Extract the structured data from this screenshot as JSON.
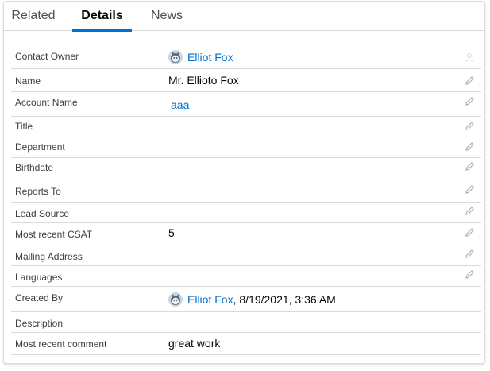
{
  "tabs": [
    {
      "label": "Related"
    },
    {
      "label": "Details"
    },
    {
      "label": "News"
    }
  ],
  "accent_color": "#0070d2",
  "fields": {
    "contact_owner": {
      "label": "Contact Owner",
      "value": "Elliot Fox",
      "icon": "user-avatar-icon"
    },
    "name": {
      "label": "Name",
      "value": "Mr. Ellioto Fox"
    },
    "account_name": {
      "label": "Account Name",
      "value": "aaa"
    },
    "title": {
      "label": "Title",
      "value": ""
    },
    "department": {
      "label": "Department",
      "value": ""
    },
    "birthdate": {
      "label": "Birthdate",
      "value": ""
    },
    "reports_to": {
      "label": "Reports To",
      "value": ""
    },
    "lead_source": {
      "label": "Lead Source",
      "value": ""
    },
    "most_recent_csat": {
      "label": "Most recent CSAT",
      "value": "5"
    },
    "mailing_address": {
      "label": "Mailing Address",
      "value": ""
    },
    "languages": {
      "label": "Languages",
      "value": ""
    },
    "created_by": {
      "label": "Created By",
      "user": "Elliot Fox",
      "date": ", 8/19/2021, 3:36 AM"
    },
    "description": {
      "label": "Description",
      "value": ""
    },
    "most_recent_comment": {
      "label": "Most recent comment",
      "value": "great work"
    }
  }
}
